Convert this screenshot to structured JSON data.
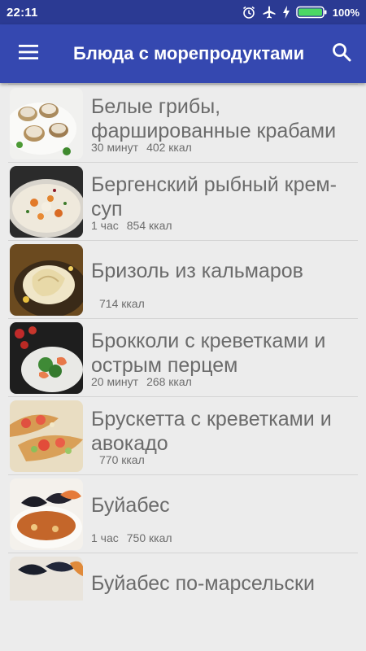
{
  "status_bar": {
    "time": "22:11",
    "battery": "100%",
    "icons": [
      "alarm-icon",
      "airplane-icon",
      "charging-icon",
      "battery-icon"
    ]
  },
  "app_bar": {
    "title": "Блюда с морепродуктами",
    "menu_icon": "menu-icon",
    "search_icon": "search-icon",
    "color": "#3548b0"
  },
  "recipes": [
    {
      "title": "",
      "time": "",
      "kcal": ""
    },
    {
      "title": "Белые грибы, фаршированные крабами",
      "time": "30 минут",
      "kcal": "402 ккал"
    },
    {
      "title": "Бергенский рыбный крем-суп",
      "time": "1 час",
      "kcal": "854 ккал"
    },
    {
      "title": "Бризоль из кальмаров",
      "time": "",
      "kcal": "714 ккал"
    },
    {
      "title": "Брокколи с креветками и острым перцем",
      "time": "20 минут",
      "kcal": "268 ккал"
    },
    {
      "title": "Брускетта с креветками и авокадо",
      "time": "",
      "kcal": "770 ккал"
    },
    {
      "title": "Буйабес",
      "time": "1 час",
      "kcal": "750 ккал"
    },
    {
      "title": "Буйабес по-марсельски",
      "time": "",
      "kcal": ""
    }
  ]
}
